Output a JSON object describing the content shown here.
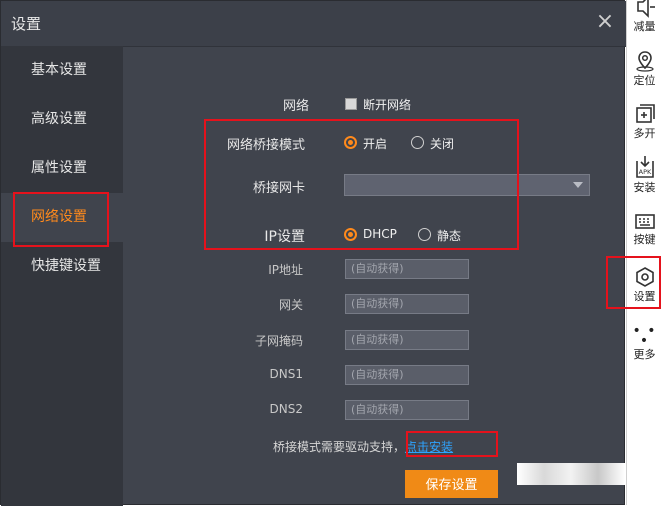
{
  "window": {
    "title": "设置",
    "close_glyph": "×"
  },
  "nav": {
    "items": [
      {
        "label": "基本设置",
        "active": false
      },
      {
        "label": "高级设置",
        "active": false
      },
      {
        "label": "属性设置",
        "active": false
      },
      {
        "label": "网络设置",
        "active": true
      },
      {
        "label": "快捷键设置",
        "active": false
      }
    ]
  },
  "network": {
    "label": "网络",
    "disconnect_label": "断开网络",
    "disconnect_checked": false
  },
  "bridge_mode": {
    "label": "网络桥接模式",
    "options": [
      {
        "label": "开启",
        "selected": true
      },
      {
        "label": "关闭",
        "selected": false
      }
    ]
  },
  "bridge_nic": {
    "label": "桥接网卡",
    "value": ""
  },
  "ip_setting": {
    "label": "IP设置",
    "options": [
      {
        "label": "DHCP",
        "selected": true
      },
      {
        "label": "静态",
        "selected": false
      }
    ]
  },
  "fields": [
    {
      "label": "IP地址",
      "placeholder": "(自动获得)"
    },
    {
      "label": "网关",
      "placeholder": "(自动获得)"
    },
    {
      "label": "子网掩码",
      "placeholder": "(自动获得)"
    },
    {
      "label": "DNS1",
      "placeholder": "(自动获得)"
    },
    {
      "label": "DNS2",
      "placeholder": "(自动获得)"
    }
  ],
  "driver_hint": {
    "text": "桥接模式需要驱动支持",
    "sep": "，",
    "link": "点击安装"
  },
  "save_label": "保存设置",
  "rightbar": {
    "items": [
      {
        "label": "减量",
        "icon": "volume-down-icon"
      },
      {
        "label": "定位",
        "icon": "location-icon"
      },
      {
        "label": "多开",
        "icon": "multi-open-icon"
      },
      {
        "label": "安装",
        "icon": "apk-install-icon"
      },
      {
        "label": "按键",
        "icon": "keyboard-icon"
      },
      {
        "label": "设置",
        "icon": "gear-icon"
      },
      {
        "label": "更多",
        "icon": "more-icon"
      }
    ]
  },
  "colors": {
    "accent": "#f08a16",
    "highlight_box": "#e5121c",
    "link": "#2ea4ff",
    "panel": "#40444d",
    "nav_bg": "#33363d"
  }
}
